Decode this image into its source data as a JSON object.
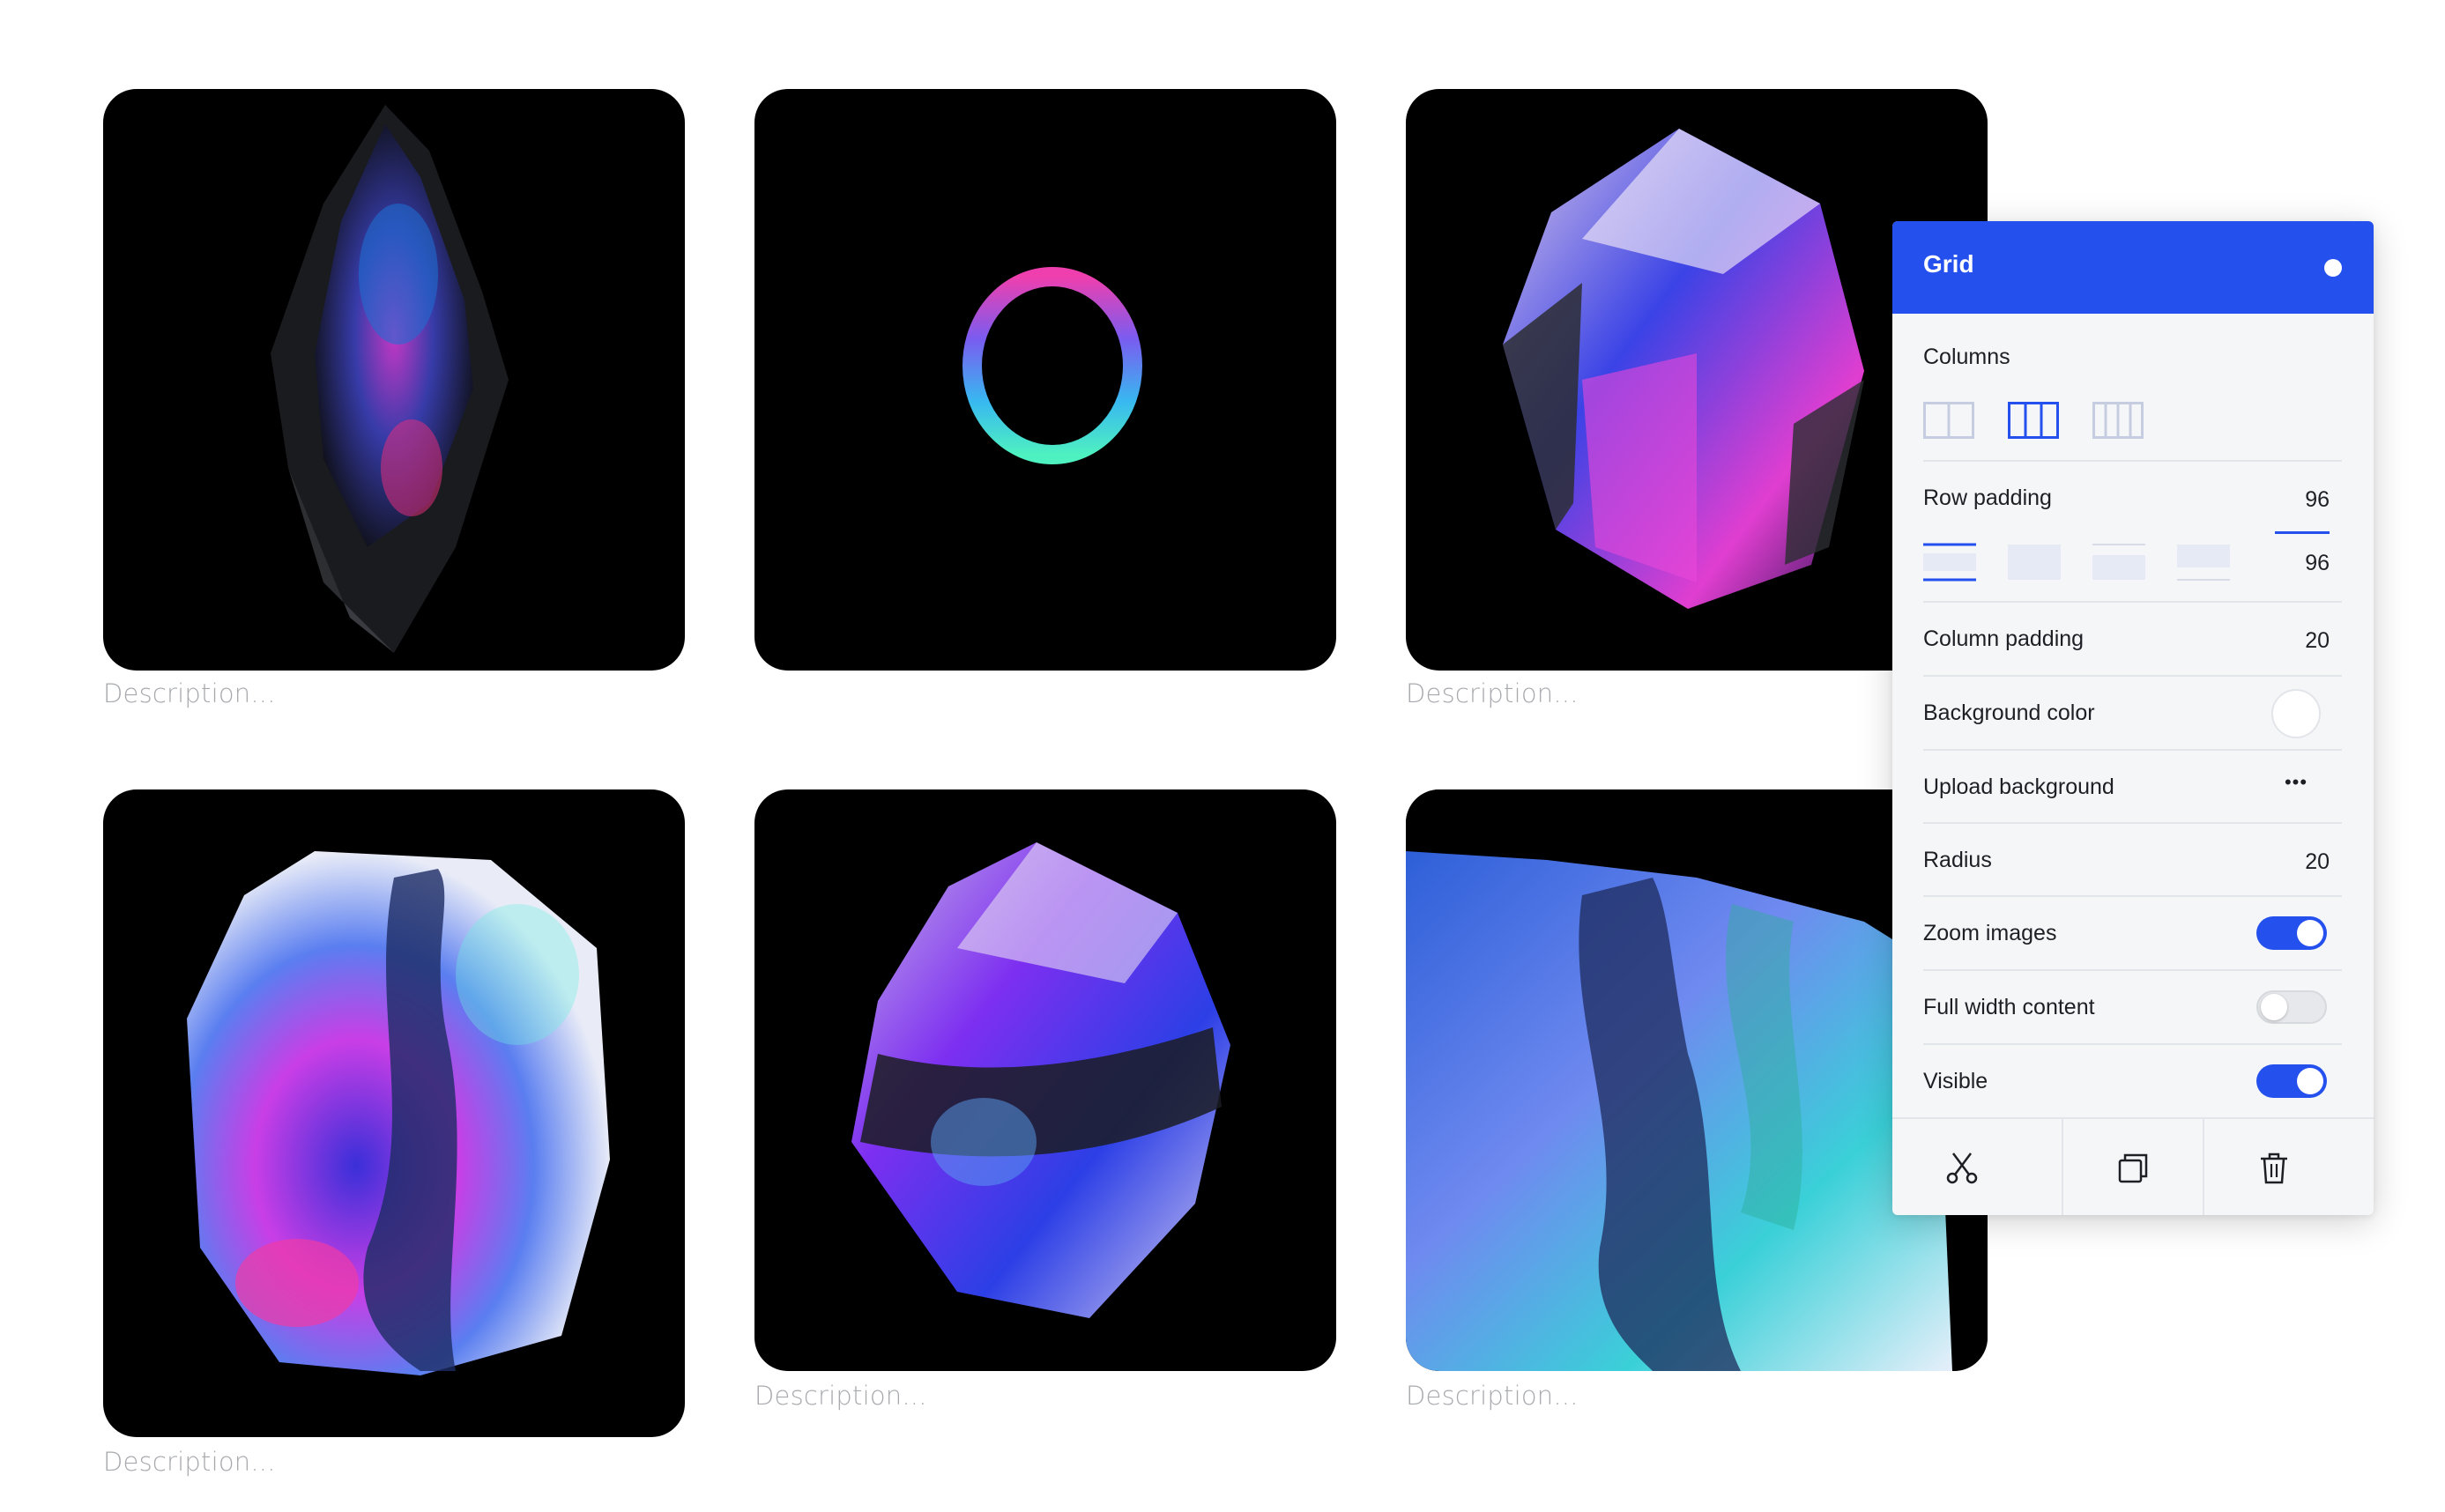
{
  "gallery": {
    "items": [
      {
        "description": "Description...",
        "image": "dark-crystal-shard"
      },
      {
        "description": "",
        "image": "gradient-ring"
      },
      {
        "description": "Description...",
        "image": "purple-crystal"
      },
      {
        "description": "Description...",
        "image": "glowing-crystal-rock"
      },
      {
        "description": "Description...",
        "image": "faceted-crystal"
      },
      {
        "description": "Description...",
        "image": "blue-crystal-closeup"
      }
    ]
  },
  "panel": {
    "title": "Grid",
    "accent_color": "#2450ee",
    "columns": {
      "label": "Columns",
      "options": [
        "two-columns-icon",
        "three-columns-icon",
        "four-columns-icon"
      ],
      "selected": 1
    },
    "row_padding": {
      "label": "Row padding",
      "top": "96",
      "bottom": "96",
      "options": [
        "top-padding-icon",
        "full-padding-icon",
        "middle-padding-icon",
        "bottom-padding-icon"
      ],
      "selected": 0
    },
    "column_padding": {
      "label": "Column padding",
      "value": "20"
    },
    "background_color": {
      "label": "Background color",
      "value": "#ffffff"
    },
    "upload_background": {
      "label": "Upload background",
      "action": "•••"
    },
    "radius": {
      "label": "Radius",
      "value": "20"
    },
    "zoom_images": {
      "label": "Zoom images",
      "on": true
    },
    "full_width_content": {
      "label": "Full width content",
      "on": false
    },
    "visible": {
      "label": "Visible",
      "on": true
    },
    "actions": [
      "cut-icon",
      "duplicate-icon",
      "trash-icon"
    ]
  }
}
